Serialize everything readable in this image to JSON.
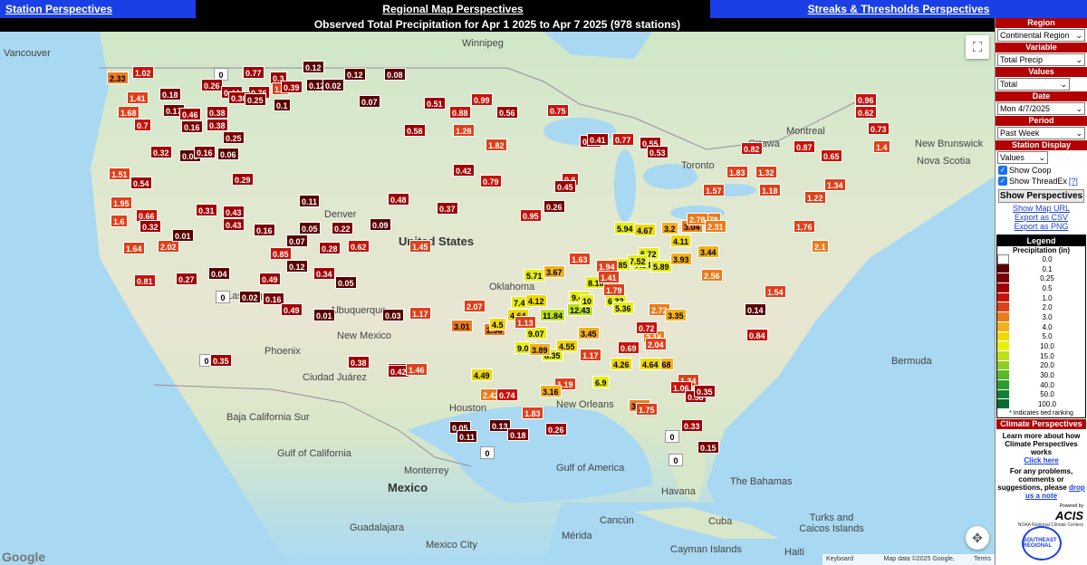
{
  "nav": {
    "station": "Station Perspectives",
    "regional": "Regional Map Perspectives",
    "streaks": "Streaks & Thresholds Perspectives"
  },
  "map": {
    "title": "Observed Total Precipitation for Apr 1 2025 to Apr 7 2025 (978 stations)",
    "labels": [
      {
        "text": "Vancouver",
        "cls": ""
      },
      {
        "text": "Winnipeg",
        "cls": ""
      },
      {
        "text": "Toronto",
        "cls": ""
      },
      {
        "text": "Ottawa",
        "cls": ""
      },
      {
        "text": "Montreal",
        "cls": ""
      },
      {
        "text": "Denver",
        "cls": ""
      },
      {
        "text": "United States",
        "cls": "big"
      },
      {
        "text": "Las Vegas",
        "cls": ""
      },
      {
        "text": "Phoenix",
        "cls": ""
      },
      {
        "text": "Albuquerque",
        "cls": ""
      },
      {
        "text": "Ciudad Juárez",
        "cls": ""
      },
      {
        "text": "New Orleans",
        "cls": ""
      },
      {
        "text": "Houston",
        "cls": ""
      },
      {
        "text": "Mexico",
        "cls": "big"
      },
      {
        "text": "Monterrey",
        "cls": ""
      },
      {
        "text": "Guadalajara",
        "cls": ""
      },
      {
        "text": "Mexico City",
        "cls": ""
      },
      {
        "text": "Havana",
        "cls": ""
      },
      {
        "text": "Cuba",
        "cls": ""
      },
      {
        "text": "The Bahamas",
        "cls": ""
      },
      {
        "text": "Bermuda",
        "cls": ""
      },
      {
        "text": "Cayman Islands",
        "cls": ""
      },
      {
        "text": "Haiti",
        "cls": ""
      },
      {
        "text": "Turks and Caicos Islands",
        "cls": ""
      },
      {
        "text": "Gulf of America",
        "cls": ""
      },
      {
        "text": "New Brunswick",
        "cls": ""
      },
      {
        "text": "Nova Scotia",
        "cls": ""
      },
      {
        "text": "Baja California Sur",
        "cls": ""
      },
      {
        "text": "Cancún",
        "cls": ""
      },
      {
        "text": "Gulf of California",
        "cls": ""
      },
      {
        "text": "Oklahoma",
        "cls": ""
      },
      {
        "text": "New Mexico",
        "cls": ""
      },
      {
        "text": "Mérida",
        "cls": ""
      }
    ],
    "stations": [
      {
        "v": "2.33",
        "c": 3.0
      },
      {
        "v": "1.02",
        "c": 1.0
      },
      {
        "v": "0",
        "c": 0
      },
      {
        "v": "0.77",
        "c": 0.5
      },
      {
        "v": "0.3",
        "c": 0.3
      },
      {
        "v": "0.12",
        "c": 0.1
      },
      {
        "v": "0.12",
        "c": 0.1
      },
      {
        "v": "0.08",
        "c": 0.05
      },
      {
        "v": "0.26",
        "c": 0.3
      },
      {
        "v": "0.44",
        "c": 0.4
      },
      {
        "v": "0.76",
        "c": 0.5
      },
      {
        "v": "1.5",
        "c": 1.5
      },
      {
        "v": "0.39",
        "c": 0.3
      },
      {
        "v": "0.12",
        "c": 0.1
      },
      {
        "v": "0.02",
        "c": 0.02
      },
      {
        "v": "1.41",
        "c": 1.4
      },
      {
        "v": "0.18",
        "c": 0.2
      },
      {
        "v": "0.36",
        "c": 0.3
      },
      {
        "v": "0.25",
        "c": 0.25
      },
      {
        "v": "0.07",
        "c": 0.05
      },
      {
        "v": "0.51",
        "c": 0.5
      },
      {
        "v": "0.99",
        "c": 0.99
      },
      {
        "v": "1.68",
        "c": 1.6
      },
      {
        "v": "0.17",
        "c": 0.2
      },
      {
        "v": "0.46",
        "c": 0.4
      },
      {
        "v": "0.38",
        "c": 0.4
      },
      {
        "v": "0.1",
        "c": 0.1
      },
      {
        "v": "0.88",
        "c": 0.8
      },
      {
        "v": "0.56",
        "c": 0.5
      },
      {
        "v": "0.75",
        "c": 0.75
      },
      {
        "v": "0.7",
        "c": 0.7
      },
      {
        "v": "0.16",
        "c": 0.15
      },
      {
        "v": "0.38",
        "c": 0.4
      },
      {
        "v": "0.25",
        "c": 0.25
      },
      {
        "v": "0.58",
        "c": 0.5
      },
      {
        "v": "1.28",
        "c": 1.3
      },
      {
        "v": "1.82",
        "c": 1.8
      },
      {
        "v": "1.51",
        "c": 1.5
      },
      {
        "v": "0.54",
        "c": 0.5
      },
      {
        "v": "0.32",
        "c": 0.3
      },
      {
        "v": "0.03",
        "c": 0.03
      },
      {
        "v": "0.16",
        "c": 0.15
      },
      {
        "v": "0.06",
        "c": 0.05
      },
      {
        "v": "0.29",
        "c": 0.3
      },
      {
        "v": "1.95",
        "c": 2.0
      },
      {
        "v": "0.66",
        "c": 0.6
      },
      {
        "v": "0.31",
        "c": 0.3
      },
      {
        "v": "0.43",
        "c": 0.4
      },
      {
        "v": "0.07",
        "c": 0.05
      },
      {
        "v": "0.11",
        "c": 0.1
      },
      {
        "v": "0.48",
        "c": 0.5
      },
      {
        "v": "1.6",
        "c": 1.6
      },
      {
        "v": "0.32",
        "c": 0.3
      },
      {
        "v": "0.43",
        "c": 0.4
      },
      {
        "v": "0.16",
        "c": 0.15
      },
      {
        "v": "0.05",
        "c": 0.05
      },
      {
        "v": "0.22",
        "c": 0.2
      },
      {
        "v": "0.09",
        "c": 0.1
      },
      {
        "v": "1.64",
        "c": 1.6
      },
      {
        "v": "2.02",
        "c": 2.0
      },
      {
        "v": "0.01",
        "c": 0.01
      },
      {
        "v": "0.85",
        "c": 0.8
      },
      {
        "v": "0.28",
        "c": 0.3
      },
      {
        "v": "0.62",
        "c": 0.6
      },
      {
        "v": "1.45",
        "c": 1.4
      },
      {
        "v": "0.81",
        "c": 0.8
      },
      {
        "v": "0.27",
        "c": 0.3
      },
      {
        "v": "0.04",
        "c": 0.04
      },
      {
        "v": "0.49",
        "c": 0.5
      },
      {
        "v": "0.12",
        "c": 0.1
      },
      {
        "v": "0.34",
        "c": 0.3
      },
      {
        "v": "0.05",
        "c": 0.05
      },
      {
        "v": "0",
        "c": 0
      },
      {
        "v": "0.02",
        "c": 0.02
      },
      {
        "v": "0.16",
        "c": 0.15
      },
      {
        "v": "0.49",
        "c": 0.5
      },
      {
        "v": "0.01",
        "c": 0.01
      },
      {
        "v": "0.03",
        "c": 0.03
      },
      {
        "v": "1.17",
        "c": 1.2
      },
      {
        "v": "0",
        "c": 0
      },
      {
        "v": "0.35",
        "c": 0.3
      },
      {
        "v": "0.38",
        "c": 0.4
      },
      {
        "v": "0.52",
        "c": 0.5
      },
      {
        "v": "0.42",
        "c": 0.4
      },
      {
        "v": "1.46",
        "c": 1.4
      },
      {
        "v": "3.01",
        "c": 3.0
      },
      {
        "v": "2.07",
        "c": 2.0
      },
      {
        "v": "2.96",
        "c": 3.0
      },
      {
        "v": "7.49",
        "c": 7.5
      },
      {
        "v": "4.12",
        "c": 4.1
      },
      {
        "v": "4.64",
        "c": 4.6
      },
      {
        "v": "11.84",
        "c": 11.8
      },
      {
        "v": "12.43",
        "c": 12.4
      },
      {
        "v": "4.5",
        "c": 4.5
      },
      {
        "v": "9.07",
        "c": 9.0
      },
      {
        "v": "8.35",
        "c": 8.3
      },
      {
        "v": "9.08",
        "c": 9.0
      },
      {
        "v": "3.89",
        "c": 3.9
      },
      {
        "v": "4.55",
        "c": 4.5
      },
      {
        "v": "3.45",
        "c": 3.4
      },
      {
        "v": "5.71",
        "c": 5.7
      },
      {
        "v": "3.67",
        "c": 3.7
      },
      {
        "v": "8.16",
        "c": 8.1
      },
      {
        "v": "9.47",
        "c": 9.4
      },
      {
        "v": "10",
        "c": 10.0
      },
      {
        "v": "6.32",
        "c": 6.3
      },
      {
        "v": "5.36",
        "c": 5.3
      },
      {
        "v": "5.94",
        "c": 5.9
      },
      {
        "v": "4.67",
        "c": 4.6
      },
      {
        "v": "3.2",
        "c": 3.2
      },
      {
        "v": "3.04",
        "c": 3.0
      },
      {
        "v": "4.11",
        "c": 4.1
      },
      {
        "v": "5.72",
        "c": 5.7
      },
      {
        "v": "7.94",
        "c": 7.9
      },
      {
        "v": "7.52",
        "c": 7.5
      },
      {
        "v": "6.85",
        "c": 6.8
      },
      {
        "v": "5.89",
        "c": 5.8
      },
      {
        "v": "3.93",
        "c": 3.9
      },
      {
        "v": "3.44",
        "c": 3.4
      },
      {
        "v": "2.79",
        "c": 2.8
      },
      {
        "v": "2.78",
        "c": 2.8
      },
      {
        "v": "2.31",
        "c": 2.3
      },
      {
        "v": "1.57",
        "c": 1.5
      },
      {
        "v": "1.83",
        "c": 1.8
      },
      {
        "v": "1.32",
        "c": 1.3
      },
      {
        "v": "1.18",
        "c": 1.2
      },
      {
        "v": "0.96",
        "c": 0.96
      },
      {
        "v": "0.73",
        "c": 0.7
      },
      {
        "v": "1.4",
        "c": 1.4
      },
      {
        "v": "0.82",
        "c": 0.8
      },
      {
        "v": "0.87",
        "c": 0.8
      },
      {
        "v": "0.65",
        "c": 0.6
      },
      {
        "v": "0.62",
        "c": 0.6
      },
      {
        "v": "1.34",
        "c": 1.3
      },
      {
        "v": "1.22",
        "c": 1.2
      },
      {
        "v": "1.76",
        "c": 1.7
      },
      {
        "v": "2.1",
        "c": 2.1
      },
      {
        "v": "1.54",
        "c": 1.5
      },
      {
        "v": "0.14",
        "c": 0.1
      },
      {
        "v": "0.84",
        "c": 0.8
      },
      {
        "v": "3.68",
        "c": 3.7
      },
      {
        "v": "4.26",
        "c": 4.2
      },
      {
        "v": "4.64",
        "c": 4.6
      },
      {
        "v": "3.02",
        "c": 3.0
      },
      {
        "v": "1.75",
        "c": 1.7
      },
      {
        "v": "1.34",
        "c": 1.3
      },
      {
        "v": "1.06",
        "c": 1.0
      },
      {
        "v": "0.58",
        "c": 0.5
      },
      {
        "v": "0.35",
        "c": 0.3
      },
      {
        "v": "0.33",
        "c": 0.3
      },
      {
        "v": "0.15",
        "c": 0.15
      },
      {
        "v": "0",
        "c": 0
      },
      {
        "v": "0.05",
        "c": 0.05
      },
      {
        "v": "0.13",
        "c": 0.1
      },
      {
        "v": "0.18",
        "c": 0.2
      },
      {
        "v": "0.26",
        "c": 0.3
      },
      {
        "v": "1.19",
        "c": 1.2
      },
      {
        "v": "3.16",
        "c": 3.2
      },
      {
        "v": "6.9",
        "c": 6.9
      },
      {
        "v": "1.83",
        "c": 1.8
      },
      {
        "v": "4.49",
        "c": 4.5
      },
      {
        "v": "2.42",
        "c": 2.4
      },
      {
        "v": "0.74",
        "c": 0.7
      },
      {
        "v": "0.11",
        "c": 0.1
      },
      {
        "v": "0",
        "c": 0
      },
      {
        "v": "0.51",
        "c": 0.5
      },
      {
        "v": "0.41",
        "c": 0.4
      },
      {
        "v": "0.77",
        "c": 0.7
      },
      {
        "v": "0.55",
        "c": 0.5
      },
      {
        "v": "0.53",
        "c": 0.5
      },
      {
        "v": "0.37",
        "c": 0.3
      },
      {
        "v": "0.42",
        "c": 0.4
      },
      {
        "v": "0.79",
        "c": 0.7
      },
      {
        "v": "0.95",
        "c": 0.9
      },
      {
        "v": "0.26",
        "c": 0.25
      },
      {
        "v": "0.6",
        "c": 0.6
      },
      {
        "v": "0.45",
        "c": 0.4
      },
      {
        "v": "1.63",
        "c": 1.6
      },
      {
        "v": "1.94",
        "c": 1.9
      },
      {
        "v": "1.41",
        "c": 1.4
      },
      {
        "v": "1.79",
        "c": 1.7
      },
      {
        "v": "1.13",
        "c": 1.1
      },
      {
        "v": "2.72",
        "c": 2.7
      },
      {
        "v": "3.35",
        "c": 3.3
      },
      {
        "v": "2.56",
        "c": 2.5
      },
      {
        "v": "2.15",
        "c": 2.1
      },
      {
        "v": "2.04",
        "c": 2.0
      },
      {
        "v": "1.17",
        "c": 1.1
      },
      {
        "v": "0.69",
        "c": 0.6
      },
      {
        "v": "0.72",
        "c": 0.7
      },
      {
        "v": "0",
        "c": 0
      }
    ]
  },
  "side": {
    "region_hdr": "Region",
    "region_val": "Continental Region",
    "variable_hdr": "Variable",
    "variable_val": "Total Precip",
    "values_hdr": "Values",
    "values_val": "Total",
    "date_hdr": "Date",
    "date_val": "Mon 4/7/2025",
    "period_hdr": "Period",
    "period_val": "Past Week",
    "display_hdr": "Station Display",
    "display_val": "Values",
    "show_coop": "Show Coop",
    "show_threadex": "Show ThreadEx",
    "threadex_help": "[?]",
    "show_btn": "Show Perspectives",
    "map_url": "Show Map URL",
    "export_csv": "Export as CSV",
    "export_png": "Export as PNG",
    "legend_title": "Legend",
    "legend_sub": "Precipitation (in)",
    "legend_rows": [
      {
        "label": "0.0",
        "color": "#ffffff"
      },
      {
        "label": "0.1",
        "color": "#5a0000"
      },
      {
        "label": "0.25",
        "color": "#7a0000"
      },
      {
        "label": "0.5",
        "color": "#a00000"
      },
      {
        "label": "1.0",
        "color": "#c8140a"
      },
      {
        "label": "2.0",
        "color": "#e0401a"
      },
      {
        "label": "3.0",
        "color": "#ee7a1a"
      },
      {
        "label": "4.0",
        "color": "#f4b01a"
      },
      {
        "label": "5.0",
        "color": "#f0d800"
      },
      {
        "label": "10.0",
        "color": "#e6ee10"
      },
      {
        "label": "15.0",
        "color": "#bde01a"
      },
      {
        "label": "20.0",
        "color": "#8cce24"
      },
      {
        "label": "30.0",
        "color": "#58b82c"
      },
      {
        "label": "40.0",
        "color": "#2a9c34"
      },
      {
        "label": "50.0",
        "color": "#138038"
      },
      {
        "label": "100.0",
        "color": "#0a6a34"
      }
    ],
    "tied_note": "* Indicates tied ranking",
    "cp_title": "Climate Perspectives",
    "learn_more": "Learn more about how Climate Perspectives works",
    "click_here": "Click here",
    "problems": "For any problems, comments or suggestions, please",
    "drop_note": "drop us a note",
    "powered_by": "Powered by",
    "acis": "ACIS",
    "noaa": "NOAA Regional Climate Centers",
    "se_badge": "SOUTHEAST REGIONAL"
  },
  "attribution": {
    "shortcuts": "Keyboard shortcuts",
    "data": "Map data ©2025 Google, INEGI",
    "terms": "Terms",
    "google": "Google"
  },
  "colors": {
    "nav_blue": "#1a3fe6",
    "header_red": "#b30000"
  }
}
